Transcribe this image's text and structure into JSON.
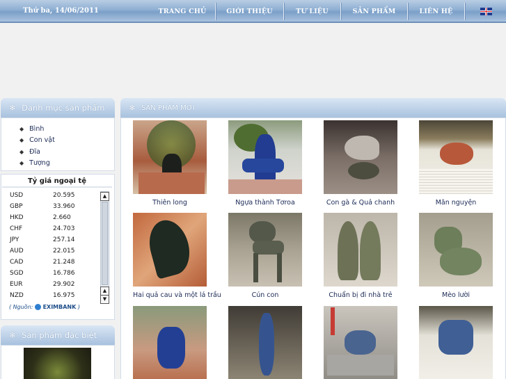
{
  "header": {
    "date": "Thứ ba, 14/06/2011",
    "nav": [
      {
        "label": "TRANG CHỦ"
      },
      {
        "label": "GIỚI THIỆU"
      },
      {
        "label": "TƯ LIỆU"
      },
      {
        "label": "SẢN PHẨM"
      },
      {
        "label": "LIÊN HỆ"
      }
    ],
    "language_icon": "uk-flag-icon"
  },
  "sidebar": {
    "categories": {
      "title": "Danh mục sản phẩm",
      "items": [
        "Bình",
        "Con vật",
        "Đĩa",
        "Tượng"
      ]
    },
    "exchange": {
      "title": "Tỷ giá ngoại tệ",
      "rows": [
        {
          "code": "USD",
          "rate": "20.595"
        },
        {
          "code": "GBP",
          "rate": "33.960"
        },
        {
          "code": "HKD",
          "rate": "2.660"
        },
        {
          "code": "CHF",
          "rate": "24.703"
        },
        {
          "code": "JPY",
          "rate": "257.14"
        },
        {
          "code": "AUD",
          "rate": "22.015"
        },
        {
          "code": "CAD",
          "rate": "21.248"
        },
        {
          "code": "SGD",
          "rate": "16.786"
        },
        {
          "code": "EUR",
          "rate": "29.902"
        },
        {
          "code": "NZD",
          "rate": "16.975"
        }
      ],
      "source_prefix": "( Nguồn:",
      "source_name": "EXIMBANK",
      "source_suffix": ")"
    },
    "special": {
      "title": "Sản phẩm đặc biệt"
    }
  },
  "main": {
    "title": "SẢN PHẨM MỚI",
    "products": [
      {
        "name": "Thiên long"
      },
      {
        "name": "Ngựa thành Tơroa"
      },
      {
        "name": "Con gà & Quả chanh"
      },
      {
        "name": "Mãn nguyện"
      },
      {
        "name": "Hai quả cau và một lá trầu"
      },
      {
        "name": "Cún con"
      },
      {
        "name": "Chuẩn bị đi nhà trẻ"
      },
      {
        "name": "Mèo lười"
      },
      {
        "name": ""
      },
      {
        "name": ""
      },
      {
        "name": ""
      },
      {
        "name": ""
      }
    ]
  },
  "colors": {
    "header_bar": "#8eafd3",
    "panel_header": "#a8c1de",
    "link_text": "#1b2a55"
  }
}
